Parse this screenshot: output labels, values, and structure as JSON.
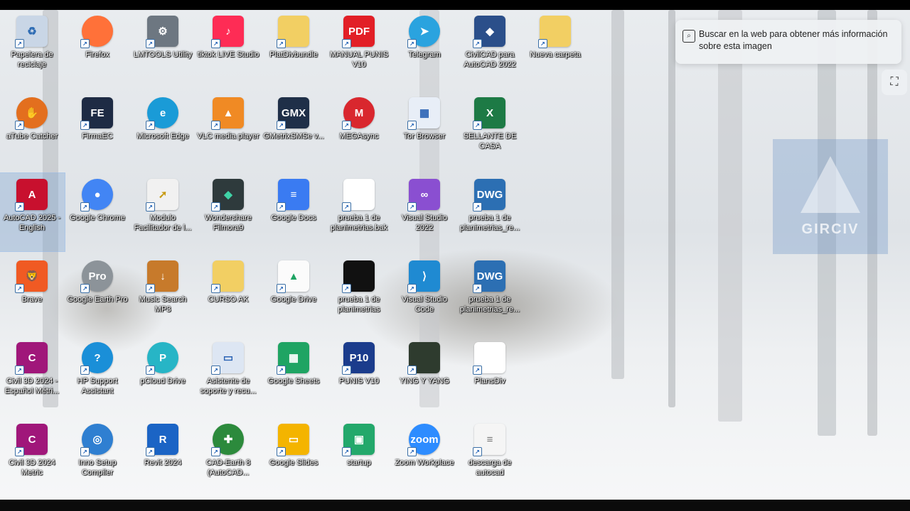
{
  "desktop": {
    "icons": [
      {
        "label": "Papelera de reciclaje",
        "glyph": "trash-icon",
        "text": "♻",
        "color": "#c9d6e6",
        "fg": "#2d6bb3"
      },
      {
        "label": "Firefox",
        "glyph": "firefox-icon",
        "text": "",
        "color": "#ff7139",
        "round": true
      },
      {
        "label": "LMTOOLS Utility",
        "glyph": "tools-icon",
        "text": "⚙",
        "color": "#6d7781"
      },
      {
        "label": "tiktok LIVE Studio",
        "glyph": "tiktok-icon",
        "text": "♪",
        "color": "#fe2c55"
      },
      {
        "label": "PlatDivbundle",
        "glyph": "folder-icon",
        "text": "",
        "color": "#f2cf63"
      },
      {
        "label": "MANUAL PUNIS V10",
        "glyph": "pdf-icon",
        "text": "PDF",
        "color": "#e21f26"
      },
      {
        "label": "Telegram",
        "glyph": "telegram-icon",
        "text": "➤",
        "color": "#2aa3df",
        "round": true
      },
      {
        "label": "CivilCAD para AutoCAD 2022",
        "glyph": "civilcad-icon",
        "text": "◆",
        "color": "#2b4f8a"
      },
      {
        "label": "Nueva carpeta",
        "glyph": "folder-icon",
        "text": "",
        "color": "#f2cf63"
      },
      {
        "label": "aTube Catcher",
        "glyph": "atube-icon",
        "text": "✋",
        "color": "#e36f1e",
        "round": true
      },
      {
        "label": "FirmaEC",
        "glyph": "firmaec-icon",
        "text": "FE",
        "color": "#1e2b44"
      },
      {
        "label": "Microsoft Edge",
        "glyph": "edge-icon",
        "text": "e",
        "color": "#1a9bd7",
        "round": true
      },
      {
        "label": "VLC media player",
        "glyph": "vlc-icon",
        "text": "▲",
        "color": "#f08a24",
        "fg": "#fff"
      },
      {
        "label": "GMetrixSMSe v...",
        "glyph": "gmetrix-icon",
        "text": "GMX",
        "color": "#1f2f48"
      },
      {
        "label": "MEGAsync",
        "glyph": "mega-icon",
        "text": "M",
        "color": "#d9272e",
        "round": true
      },
      {
        "label": "Tor Browser",
        "glyph": "tor-icon",
        "text": "▦",
        "color": "#e8eef7",
        "fg": "#2b63b4"
      },
      {
        "label": "SELLANTE DE CASA",
        "glyph": "excel-icon",
        "text": "X",
        "color": "#1d7a45"
      },
      {
        "label": "AutoCAD 2025 - English",
        "glyph": "autocad-icon",
        "text": "A",
        "color": "#c8102e",
        "selected": true
      },
      {
        "label": "Google Chrome",
        "glyph": "chrome-icon",
        "text": "●",
        "color": "#4285f4",
        "round": true
      },
      {
        "label": "Modulo Facilitador de l...",
        "glyph": "cursor-icon",
        "text": "➚",
        "color": "#f1f1f1",
        "fg": "#c79a12"
      },
      {
        "label": "Wondershare Filmora9",
        "glyph": "filmora-icon",
        "text": "◆",
        "color": "#2e3a3c",
        "fg": "#3fd3a6"
      },
      {
        "label": "Google Docs",
        "glyph": "docs-icon",
        "text": "≡",
        "color": "#3a7bf2"
      },
      {
        "label": "prueba 1 de planimetrias.bak",
        "glyph": "file-icon",
        "text": "",
        "color": "#ffffff"
      },
      {
        "label": "Visual Studio 2022",
        "glyph": "visual-studio-icon",
        "text": "∞",
        "color": "#8a4fd1"
      },
      {
        "label": "prueba 1 de planimetrias_re...",
        "glyph": "dwg-icon",
        "text": "DWG",
        "color": "#2c6fb3"
      },
      {
        "label": "Brave",
        "glyph": "brave-icon",
        "text": "🦁",
        "color": "#f05a23"
      },
      {
        "label": "Google Earth Pro",
        "glyph": "earth-icon",
        "text": "Pro",
        "color": "#8c9399",
        "round": true
      },
      {
        "label": "Music Search MP3",
        "glyph": "music-icon",
        "text": "↓",
        "color": "#c77a2b"
      },
      {
        "label": "CURSO AK",
        "glyph": "folder-icon",
        "text": "",
        "color": "#f2cf63"
      },
      {
        "label": "Google Drive",
        "glyph": "drive-icon",
        "text": "▲",
        "color": "#fbfbfb",
        "fg": "#1fa463"
      },
      {
        "label": "prueba 1 de planimetrias",
        "glyph": "drawing-thumbnail-icon",
        "text": "",
        "color": "#111111"
      },
      {
        "label": "Visual Studio Code",
        "glyph": "vscode-icon",
        "text": "⟩",
        "color": "#1f8ad2"
      },
      {
        "label": "prueba 1 de planimetrias_re...",
        "glyph": "dwg-icon",
        "text": "DWG",
        "color": "#2c6fb3"
      },
      {
        "label": "Civil 3D 2024 - Español Métri...",
        "glyph": "civil3d-icon",
        "text": "C",
        "color": "#a0177a"
      },
      {
        "label": "HP Support Assistant",
        "glyph": "help-icon",
        "text": "?",
        "color": "#1a8fd8",
        "round": true
      },
      {
        "label": "pCloud Drive",
        "glyph": "pcloud-icon",
        "text": "P",
        "color": "#27b5c6",
        "round": true
      },
      {
        "label": "Asistente de soporte y recu...",
        "glyph": "window-icon",
        "text": "▭",
        "color": "#dde6f3",
        "fg": "#2b63b4"
      },
      {
        "label": "Google Sheets",
        "glyph": "sheets-icon",
        "text": "▦",
        "color": "#1fa463"
      },
      {
        "label": "PUNIS V10",
        "glyph": "punis-icon",
        "text": "P10",
        "color": "#1b3c8c"
      },
      {
        "label": "YING Y YANG",
        "glyph": "image-thumbnail-icon",
        "text": "",
        "color": "#2e3b2e"
      },
      {
        "label": "PlansDiv",
        "glyph": "file-icon",
        "text": "",
        "color": "#ffffff"
      },
      {
        "label": "Civil 3D 2024 Metric",
        "glyph": "civil3d-icon",
        "text": "C",
        "color": "#a0177a"
      },
      {
        "label": "Inno Setup Compiler",
        "glyph": "inno-icon",
        "text": "◎",
        "color": "#2f7fd1",
        "round": true
      },
      {
        "label": "Revit 2024",
        "glyph": "revit-icon",
        "text": "R",
        "color": "#1b64c5"
      },
      {
        "label": "CAD-Earth 8 (AutoCAD...",
        "glyph": "cadearth-icon",
        "text": "✚",
        "color": "#2c8a3c",
        "round": true
      },
      {
        "label": "Google Slides",
        "glyph": "slides-icon",
        "text": "▭",
        "color": "#f4b400"
      },
      {
        "label": "startup",
        "glyph": "startup-icon",
        "text": "▣",
        "color": "#23a86b"
      },
      {
        "label": "Zoom Workplace",
        "glyph": "zoom-icon",
        "text": "zoom",
        "color": "#2d8cff",
        "round": true
      },
      {
        "label": "descarga de autocad",
        "glyph": "text-file-icon",
        "text": "≡",
        "color": "#f5f5f5",
        "fg": "#777"
      }
    ]
  },
  "lens_bubble": {
    "text": "Buscar en la web para obtener más información sobre esta imagen"
  },
  "watermark": {
    "text": "GIRCIV"
  }
}
